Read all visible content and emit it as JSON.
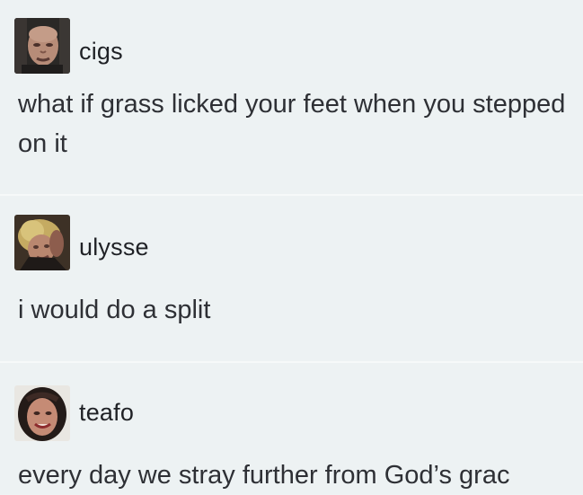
{
  "posts": [
    {
      "username": "cigs",
      "avatar_icon": "man-portrait-avatar",
      "message": "what if grass licked your feet when you stepped on it"
    },
    {
      "username": "ulysse",
      "avatar_icon": "blonde-person-avatar",
      "message": "i would do a split"
    },
    {
      "username": "teafo",
      "avatar_icon": "smiling-woman-avatar",
      "message": "every day we stray further from God’s grac"
    }
  ],
  "colors": {
    "background": "#edf2f3",
    "text": "#2e3035",
    "divider": "#f6f9f9"
  }
}
